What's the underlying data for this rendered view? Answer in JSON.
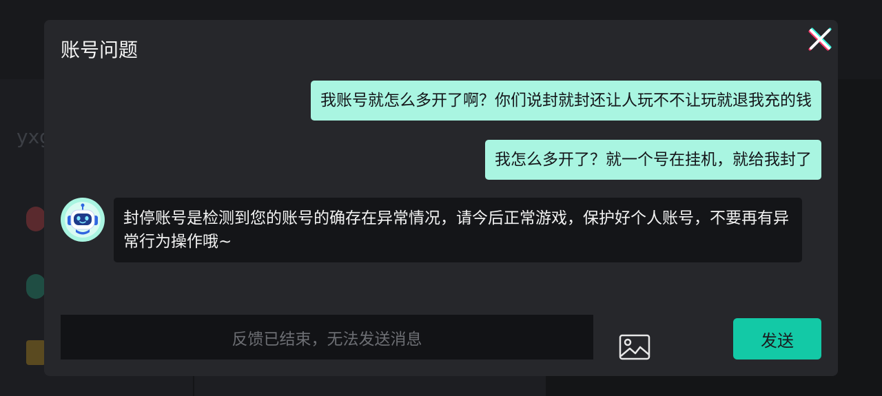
{
  "background": {
    "partial_text": "yxg"
  },
  "dialog": {
    "title": "账号问题",
    "messages": [
      {
        "sender": "user",
        "text": "我账号就怎么多开了啊？你们说封就封还让人玩不不让玩就退我充的钱"
      },
      {
        "sender": "user",
        "text": "我怎么多开了？就一个号在挂机，就给我封了"
      },
      {
        "sender": "bot",
        "text": "封停账号是检测到您的账号的确存在异常情况，请今后正常游戏，保护好个人账号，不要再有异常行为操作哦~"
      }
    ],
    "input_placeholder": "反馈已结束，无法发送消息",
    "send_label": "发送"
  },
  "colors": {
    "dialog_bg": "#26272b",
    "user_bubble": "#a9f5e1",
    "bot_bubble": "#141518",
    "accent": "#13c9a6"
  },
  "icons": {
    "close": "close-icon",
    "avatar": "robot-avatar-icon",
    "image": "image-icon"
  }
}
